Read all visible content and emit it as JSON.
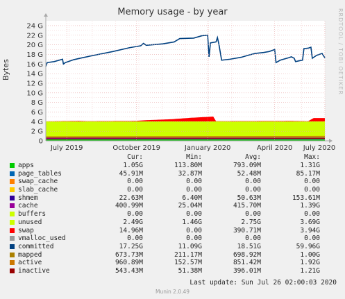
{
  "chart_data": {
    "type": "area",
    "title": "Memory usage - by year",
    "ylabel": "Bytes",
    "side_credit": "RRDTOOL / TOBI OETIKER",
    "y_ticks": [
      "0",
      "2 G",
      "4 G",
      "6 G",
      "8 G",
      "10 G",
      "12 G",
      "14 G",
      "16 G",
      "18 G",
      "20 G",
      "22 G",
      "24 G"
    ],
    "ylim": [
      0,
      25
    ],
    "xlim": [
      0,
      100
    ],
    "x_ticks": [
      {
        "label": "July 2019",
        "x": 7.5
      },
      {
        "label": "October 2019",
        "x": 32.5
      },
      {
        "label": "January 2020",
        "x": 58
      },
      {
        "label": "April 2020",
        "x": 82
      },
      {
        "label": "July 2020",
        "x": 105
      }
    ],
    "grid": true,
    "series": [
      {
        "name": "apps",
        "color": "#00cc00",
        "values": [
          {
            "x": 0,
            "y": 0.3
          },
          {
            "x": 100,
            "y": 0.3
          }
        ]
      },
      {
        "name": "page_tables",
        "color": "#0066b3",
        "values": [
          {
            "x": 0,
            "y": 0.05
          },
          {
            "x": 100,
            "y": 0.05
          }
        ]
      },
      {
        "name": "swap_cache",
        "color": "#ff8000",
        "values": [
          {
            "x": 0,
            "y": 0
          },
          {
            "x": 100,
            "y": 0
          }
        ]
      },
      {
        "name": "slab_cache",
        "color": "#ffcc00",
        "values": [
          {
            "x": 0,
            "y": 0
          },
          {
            "x": 100,
            "y": 0
          }
        ]
      },
      {
        "name": "shmem",
        "color": "#330099",
        "values": [
          {
            "x": 0,
            "y": 0.05
          },
          {
            "x": 100,
            "y": 0.05
          }
        ]
      },
      {
        "name": "cache",
        "color": "#990099",
        "values": [
          {
            "x": 0,
            "y": 0.4
          },
          {
            "x": 100,
            "y": 0.4
          }
        ]
      },
      {
        "name": "buffers",
        "color": "#ccff00",
        "values": [
          {
            "x": 0,
            "y": 0
          },
          {
            "x": 100,
            "y": 0
          }
        ]
      },
      {
        "name": "unused",
        "color": "#ccff00",
        "values": [
          {
            "x": 0,
            "y": 3.25
          },
          {
            "x": 100,
            "y": 3.25
          }
        ]
      },
      {
        "name": "swap",
        "color": "#ff0000",
        "values": [
          {
            "x": 0,
            "y": 0.02
          },
          {
            "x": 12,
            "y": 0.1
          },
          {
            "x": 15,
            "y": 0.05
          },
          {
            "x": 32,
            "y": 0.1
          },
          {
            "x": 36,
            "y": 0.25
          },
          {
            "x": 45,
            "y": 0.45
          },
          {
            "x": 52,
            "y": 0.75
          },
          {
            "x": 60,
            "y": 1.0
          },
          {
            "x": 61,
            "y": 0.05
          },
          {
            "x": 88,
            "y": 0.1
          },
          {
            "x": 94,
            "y": 0.05
          },
          {
            "x": 96,
            "y": 0.7
          },
          {
            "x": 100,
            "y": 0.7
          }
        ]
      },
      {
        "name": "vmalloc_used",
        "color": "#999999",
        "values": [
          {
            "x": 0,
            "y": 0
          },
          {
            "x": 100,
            "y": 0
          }
        ]
      },
      {
        "name": "committed",
        "color": "#004080",
        "values": [
          {
            "x": 0,
            "y": 15.5
          },
          {
            "x": 0.5,
            "y": 16.3
          },
          {
            "x": 3,
            "y": 16.5
          },
          {
            "x": 6,
            "y": 17.0
          },
          {
            "x": 6.3,
            "y": 16.0
          },
          {
            "x": 7,
            "y": 16.3
          },
          {
            "x": 10,
            "y": 16.9
          },
          {
            "x": 13,
            "y": 17.3
          },
          {
            "x": 18,
            "y": 17.9
          },
          {
            "x": 24,
            "y": 18.6
          },
          {
            "x": 30,
            "y": 19.4
          },
          {
            "x": 34,
            "y": 19.8
          },
          {
            "x": 35,
            "y": 20.3
          },
          {
            "x": 36,
            "y": 19.9
          },
          {
            "x": 42,
            "y": 20.2
          },
          {
            "x": 46,
            "y": 20.6
          },
          {
            "x": 48,
            "y": 21.3
          },
          {
            "x": 53,
            "y": 21.4
          },
          {
            "x": 56,
            "y": 21.9
          },
          {
            "x": 58,
            "y": 22.0
          },
          {
            "x": 58.5,
            "y": 17.5
          },
          {
            "x": 59,
            "y": 20.4
          },
          {
            "x": 61,
            "y": 20.6
          },
          {
            "x": 61.5,
            "y": 21.5
          },
          {
            "x": 62,
            "y": 20.2
          },
          {
            "x": 63,
            "y": 16.8
          },
          {
            "x": 66,
            "y": 17.0
          },
          {
            "x": 70,
            "y": 17.4
          },
          {
            "x": 73,
            "y": 17.9
          },
          {
            "x": 75,
            "y": 18.2
          },
          {
            "x": 78,
            "y": 18.4
          },
          {
            "x": 80,
            "y": 18.6
          },
          {
            "x": 82,
            "y": 19.0
          },
          {
            "x": 82.5,
            "y": 16.3
          },
          {
            "x": 84,
            "y": 16.8
          },
          {
            "x": 87,
            "y": 17.3
          },
          {
            "x": 88,
            "y": 17.5
          },
          {
            "x": 89,
            "y": 17.2
          },
          {
            "x": 89.5,
            "y": 16.5
          },
          {
            "x": 91,
            "y": 16.7
          },
          {
            "x": 92,
            "y": 16.8
          },
          {
            "x": 92.5,
            "y": 19.2
          },
          {
            "x": 94,
            "y": 19.3
          },
          {
            "x": 95,
            "y": 19.5
          },
          {
            "x": 95.5,
            "y": 17.2
          },
          {
            "x": 97,
            "y": 17.8
          },
          {
            "x": 99,
            "y": 18.2
          },
          {
            "x": 100,
            "y": 17.3
          }
        ]
      },
      {
        "name": "mapped",
        "color": "#aa8000",
        "values": [
          {
            "x": 0,
            "y": 0.7
          },
          {
            "x": 100,
            "y": 0.7
          }
        ]
      },
      {
        "name": "active",
        "color": "#cc7700",
        "values": [
          {
            "x": 0,
            "y": 0.85
          },
          {
            "x": 100,
            "y": 0.95
          }
        ]
      },
      {
        "name": "inactive",
        "color": "#990000",
        "values": [
          {
            "x": 0,
            "y": 0.4
          },
          {
            "x": 100,
            "y": 0.5
          }
        ]
      }
    ]
  },
  "legend": {
    "headers": {
      "cur": "Cur:",
      "min": "Min:",
      "avg": "Avg:",
      "max": "Max:"
    },
    "rows": [
      {
        "name": "apps",
        "color": "#00cc00",
        "cur": "1.05G",
        "min": "113.80M",
        "avg": "793.09M",
        "max": "1.31G"
      },
      {
        "name": "page_tables",
        "color": "#0066b3",
        "cur": "45.91M",
        "min": "32.87M",
        "avg": "52.48M",
        "max": "85.17M"
      },
      {
        "name": "swap_cache",
        "color": "#ff8000",
        "cur": "0.00",
        "min": "0.00",
        "avg": "0.00",
        "max": "0.00"
      },
      {
        "name": "slab_cache",
        "color": "#ffcc00",
        "cur": "0.00",
        "min": "0.00",
        "avg": "0.00",
        "max": "0.00"
      },
      {
        "name": "shmem",
        "color": "#330099",
        "cur": "22.63M",
        "min": "6.40M",
        "avg": "50.63M",
        "max": "153.61M"
      },
      {
        "name": "cache",
        "color": "#990099",
        "cur": "400.99M",
        "min": "25.04M",
        "avg": "415.70M",
        "max": "1.39G"
      },
      {
        "name": "buffers",
        "color": "#ccff00",
        "cur": "0.00",
        "min": "0.00",
        "avg": "0.00",
        "max": "0.00"
      },
      {
        "name": "unused",
        "color": "#ccff00",
        "cur": "2.49G",
        "min": "1.46G",
        "avg": "2.75G",
        "max": "3.69G"
      },
      {
        "name": "swap",
        "color": "#ff0000",
        "cur": "14.96M",
        "min": "0.00",
        "avg": "390.71M",
        "max": "3.94G"
      },
      {
        "name": "vmalloc_used",
        "color": "#999999",
        "cur": "0.00",
        "min": "0.00",
        "avg": "0.00",
        "max": "0.00"
      },
      {
        "name": "committed",
        "color": "#004080",
        "cur": "17.25G",
        "min": "11.09G",
        "avg": "18.51G",
        "max": "59.96G"
      },
      {
        "name": "mapped",
        "color": "#aa8000",
        "cur": "673.73M",
        "min": "211.17M",
        "avg": "698.92M",
        "max": "1.00G"
      },
      {
        "name": "active",
        "color": "#cc7700",
        "cur": "960.89M",
        "min": "152.57M",
        "avg": "851.42M",
        "max": "1.92G"
      },
      {
        "name": "inactive",
        "color": "#990000",
        "cur": "543.43M",
        "min": "51.38M",
        "avg": "396.01M",
        "max": "1.21G"
      }
    ]
  },
  "last_update": "Last update: Sun Jul 26 02:00:03 2020",
  "footer": "Munin 2.0.49"
}
